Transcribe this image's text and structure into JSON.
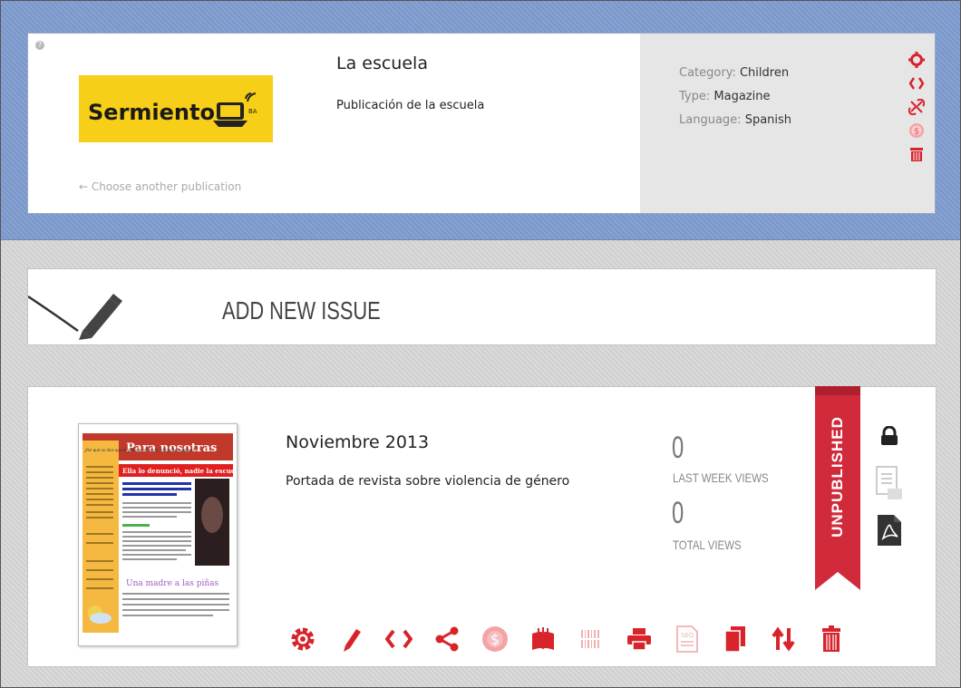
{
  "publication": {
    "help_icon": "question-icon",
    "logo": {
      "brand": "Sermiento",
      "badge": "BA",
      "bg_color": "#f7cf18"
    },
    "title": "La escuela",
    "description": "Publicación de la escuela",
    "choose_link": "← Choose another publication",
    "meta": {
      "category_label": "Category:",
      "category_value": "Children",
      "type_label": "Type:",
      "type_value": "Magazine",
      "language_label": "Language:",
      "language_value": "Spanish"
    },
    "actions": [
      "settings-gear-icon",
      "embed-code-icon",
      "unlink-icon",
      "monetize-coin-icon",
      "delete-trash-icon"
    ]
  },
  "add_issue": {
    "label": "ADD NEW ISSUE",
    "icon": "pencil-icon"
  },
  "issue": {
    "title": "Noviembre 2013",
    "description": "Portada de revista sobre violencia de género",
    "last_week_views": "0",
    "last_week_label": "LAST WEEK VIEWS",
    "total_views": "0",
    "total_label": "TOTAL VIEWS",
    "status": "UNPUBLISHED",
    "cover": {
      "header": "Para nosotras",
      "headline": "Ella lo denunció, nadie la escuchó",
      "subhead": "Una madre a las piñas",
      "sidebar_title": "¿Por qué se dice que el perro es el mejor amigo del hombre?"
    },
    "side_actions": [
      "lock-icon",
      "print-preview-icon",
      "pdf-icon"
    ],
    "toolbar": [
      "settings-icon",
      "edit-pencil-icon",
      "embed-code-icon",
      "share-icon",
      "monetize-icon",
      "bookmark-icon",
      "barcode-icon",
      "print-icon",
      "seo-icon",
      "duplicate-icon",
      "sort-icon",
      "trash-icon"
    ]
  },
  "colors": {
    "accent": "#d8232a",
    "band": "#7e9bcf",
    "ribbon": "#d12a3b"
  }
}
